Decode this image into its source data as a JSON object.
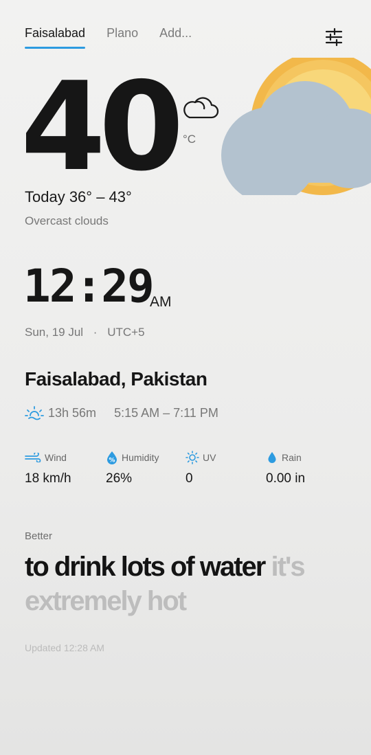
{
  "tabs": [
    {
      "label": "Faisalabad",
      "active": true
    },
    {
      "label": "Plano",
      "active": false
    },
    {
      "label": "Add...",
      "active": false
    }
  ],
  "current": {
    "temperature": "40",
    "unit": "°C",
    "today_range": "Today 36° – 43°",
    "condition": "Overcast clouds",
    "condition_icon": "cloud-icon"
  },
  "clock": {
    "time": "12:29",
    "period": "AM",
    "date": "Sun, 19 Jul",
    "separator": "·",
    "timezone": "UTC+5"
  },
  "location": {
    "name": "Faisalabad, Pakistan",
    "day_length": "13h 56m",
    "sun_times": "5:15 AM – 7:11 PM"
  },
  "stats": [
    {
      "label": "Wind",
      "value": "18 km/h",
      "icon": "wind-icon"
    },
    {
      "label": "Humidity",
      "value": "26%",
      "icon": "humidity-icon"
    },
    {
      "label": "UV",
      "value": "0",
      "icon": "uv-icon"
    },
    {
      "label": "Rain",
      "value": "0.00 in",
      "icon": "rain-drop-icon"
    }
  ],
  "advice": {
    "intro": "Better",
    "emphasis": "to drink lots of water",
    "rest": "it's extremely hot"
  },
  "updated": "Updated 12:28 AM",
  "colors": {
    "accent": "#2d9be0",
    "sun_outer": "#f2b84a",
    "sun_inner": "#f8d77a",
    "cloud": "#b3c2cf"
  }
}
